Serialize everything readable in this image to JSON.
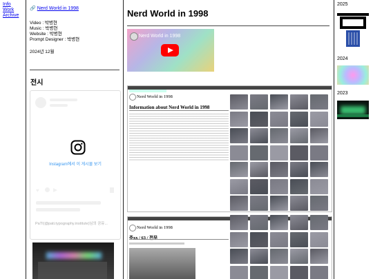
{
  "nav": {
    "items": [
      "Info",
      "Work",
      "Archive"
    ]
  },
  "project": {
    "link_text": "Nerd World in 1998",
    "credits": [
      "Video : 박병현",
      "Music : 박병현",
      "Website : 박병현",
      "Prompt Designer : 박병현"
    ],
    "date": "2024년 12월",
    "exhibition_heading": "전시"
  },
  "instagram": {
    "view_text": "Instagram에서 이 게시물 보기",
    "caption": "PaTI(@pati.typography.institute)님의 공유..."
  },
  "main": {
    "title": "Nerd World in 1998",
    "video_title": "Nerd World in 1998",
    "shot1": {
      "site_title": "Nerd World in 1998",
      "section_title": "Information about Nerd World in 1998"
    },
    "shot2": {
      "site_title": "Nerd World in 1998",
      "section_title": "주xx / 63 / 전무"
    }
  },
  "sidebar": {
    "years": [
      "2025",
      "2024",
      "2023"
    ]
  }
}
